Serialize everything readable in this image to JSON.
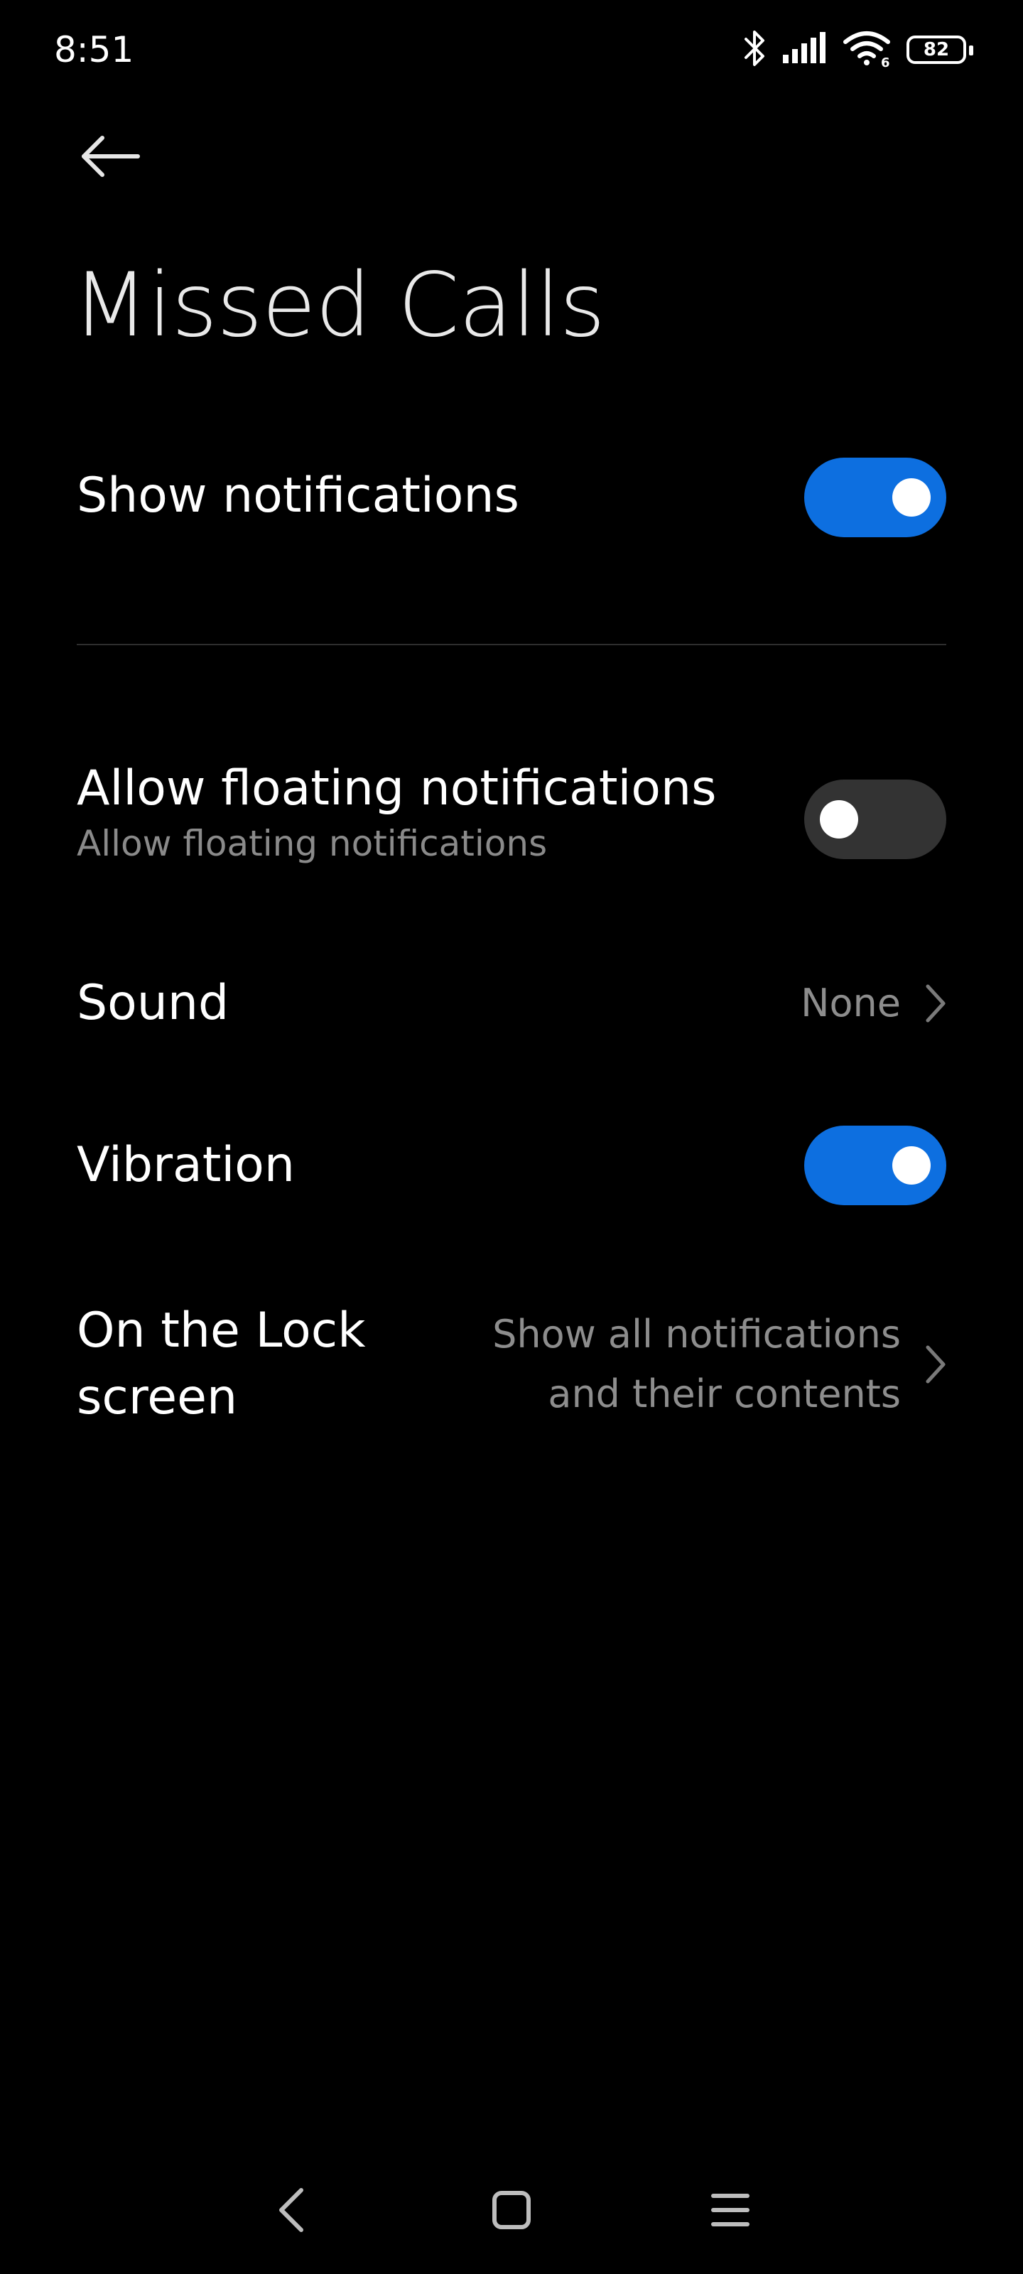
{
  "status_bar": {
    "time": "8:51",
    "battery_level": "82",
    "icons": [
      "bluetooth-icon",
      "signal-icon",
      "wifi-6-icon",
      "battery-icon"
    ]
  },
  "header": {
    "back_icon": "back-arrow-icon",
    "title": "Missed Calls"
  },
  "settings": {
    "show_notifications": {
      "label": "Show notifications",
      "enabled": true
    },
    "floating_notifications": {
      "label": "Allow floating notifications",
      "subtitle": "Allow floating notifications",
      "enabled": false
    },
    "sound": {
      "label": "Sound",
      "value": "None"
    },
    "vibration": {
      "label": "Vibration",
      "enabled": true
    },
    "lock_screen": {
      "label_line1": "On the Lock",
      "label_line2": "screen",
      "value_line1": "Show all notifications",
      "value_line2": "and their contents"
    }
  },
  "colors": {
    "background": "#000000",
    "toggle_on": "#0d6fe0",
    "toggle_off": "#333333",
    "secondary_text": "#8d8d8d"
  },
  "nav_bar": {
    "icons": [
      "nav-back-icon",
      "nav-home-icon",
      "nav-recents-icon"
    ]
  }
}
